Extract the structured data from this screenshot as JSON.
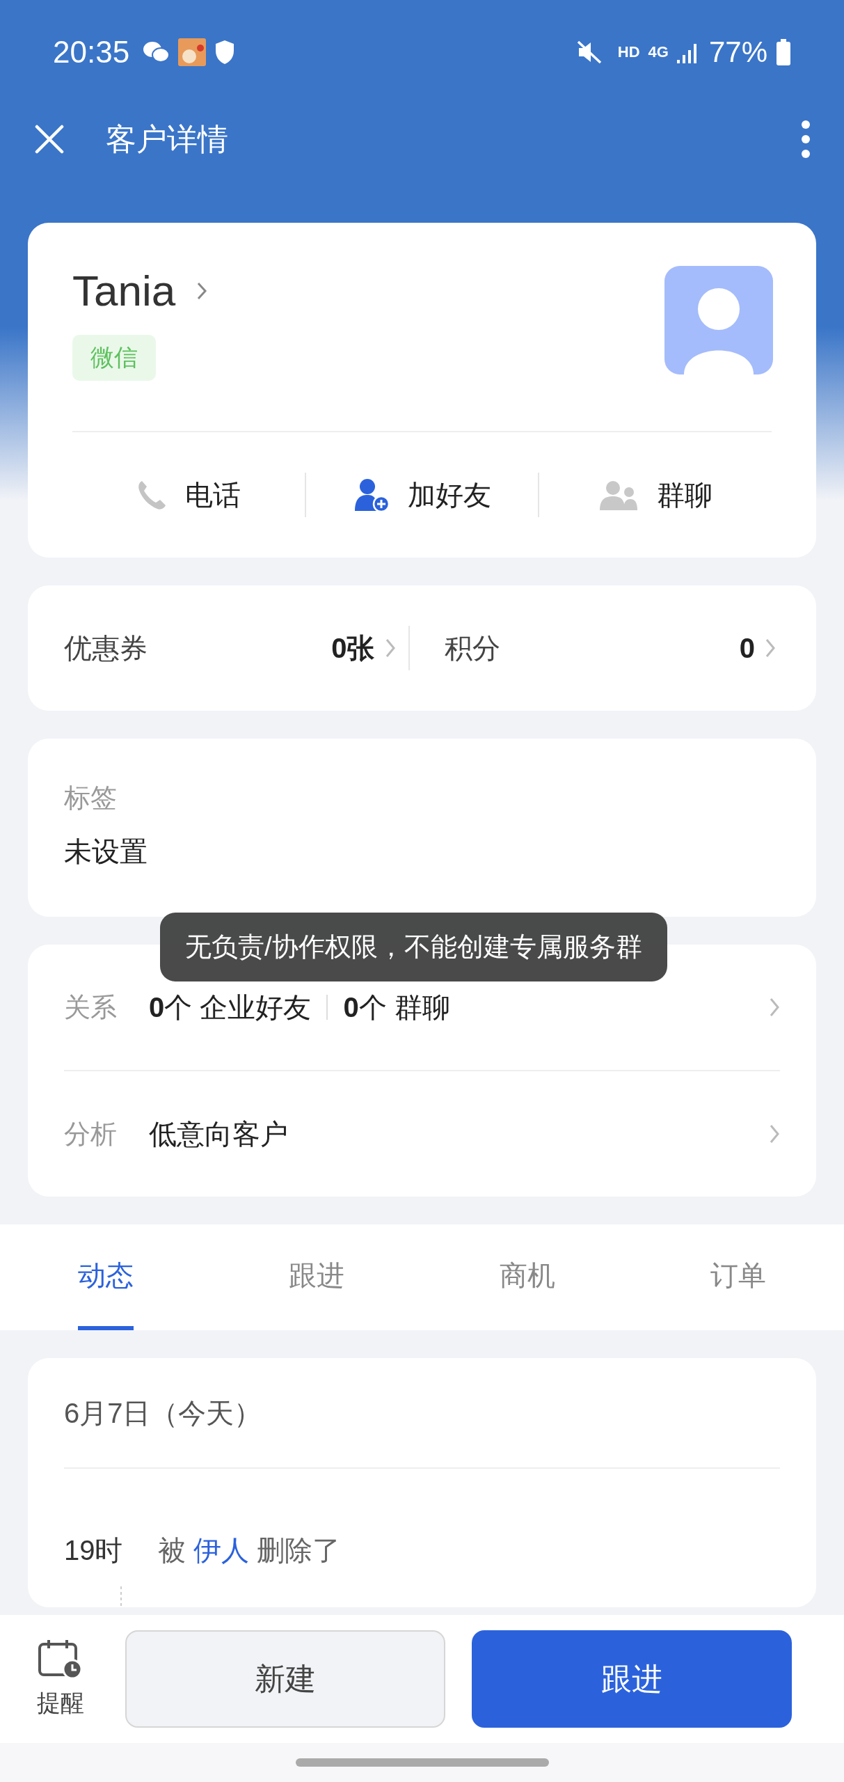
{
  "status_bar": {
    "time": "20:35",
    "hd": "HD",
    "network": "4G",
    "battery": "77%"
  },
  "nav": {
    "title": "客户详情"
  },
  "customer": {
    "name": "Tania",
    "tag": "微信",
    "actions": [
      {
        "kind": "phone",
        "label": "电话"
      },
      {
        "kind": "add_friend",
        "label": "加好友"
      },
      {
        "kind": "group",
        "label": "群聊"
      }
    ]
  },
  "benefits": [
    {
      "label": "优惠券",
      "value": "0张"
    },
    {
      "label": "积分",
      "value": "0"
    }
  ],
  "tags": {
    "label": "标签",
    "value": "未设置"
  },
  "relations": {
    "label": "关系",
    "friends": "**0**个 企业好友",
    "groups": "**0**个 群聊"
  },
  "analysis": {
    "label": "分析",
    "value": "低意向客户"
  },
  "toast": "无负责/协作权限，不能创建专属服务群",
  "tabs": [
    {
      "label": "动态",
      "selected": true
    },
    {
      "label": "跟进",
      "selected": false
    },
    {
      "label": "商机",
      "selected": false
    },
    {
      "label": "订单",
      "selected": false
    }
  ],
  "timeline": {
    "date": "6月7日（今天）",
    "events": [
      {
        "time": "19时",
        "prefix": "被",
        "actor": "伊人",
        "suffix": "删除了"
      }
    ]
  },
  "bottom_bar": {
    "reminder": "提醒",
    "buttons": [
      {
        "kind": "secondary",
        "label": "新建"
      },
      {
        "kind": "primary",
        "label": "跟进"
      }
    ]
  }
}
